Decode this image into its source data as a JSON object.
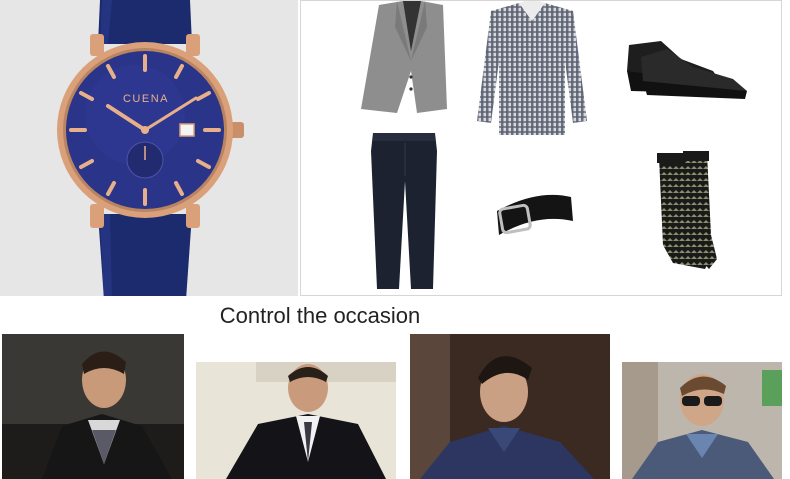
{
  "caption": "Control the occasion",
  "watch": {
    "brand": "CUENA"
  },
  "colors": {
    "strap": "#1c2a6e",
    "dial": "#2a3488",
    "rose_gold": "#d9a07a",
    "panel_bg": "#e6e6e6"
  },
  "outfit_items": [
    "blazer",
    "checked-shirt",
    "suede-shoes",
    "jeans",
    "belt",
    "socks"
  ],
  "model_photos": [
    "model-leather-jacket",
    "model-suit",
    "model-checked-shirt",
    "model-sunglasses"
  ]
}
